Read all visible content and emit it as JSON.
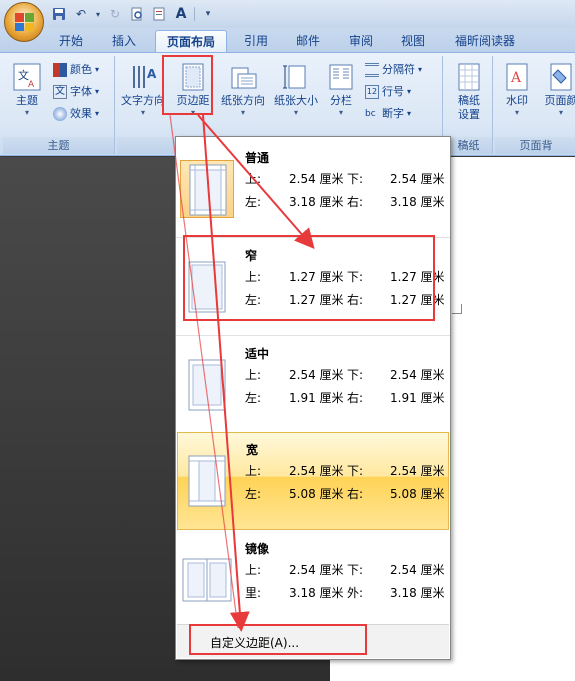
{
  "quick_access": {
    "undo": "↶",
    "redo": "↻",
    "more": "▾",
    "font_a": "A"
  },
  "tabs": [
    "开始",
    "插入",
    "页面布局",
    "引用",
    "邮件",
    "审阅",
    "视图",
    "福昕阅读器"
  ],
  "ribbon": {
    "theme_group": {
      "label": "主题",
      "big_button": "主题",
      "colors": "颜色",
      "fonts": "字体",
      "effects": "效果"
    },
    "page_setup_group": {
      "text_direction": "文字方向",
      "margins": "页边距",
      "orientation": "纸张方向",
      "size": "纸张大小",
      "columns": "分栏",
      "breaks": "分隔符",
      "line_numbers": "行号",
      "hyphenation": "断字"
    },
    "draft_group": {
      "label": "稿纸",
      "button_line1": "稿纸",
      "button_line2": "设置"
    },
    "background_group": {
      "label": "页面背",
      "watermark": "水印",
      "page_color": "页面颜"
    },
    "down_arrow": "▾"
  },
  "gallery": {
    "items": [
      {
        "name": "普通",
        "row1": [
          "上:",
          "2.54 厘米",
          "下:",
          "2.54 厘米"
        ],
        "row2": [
          "左:",
          "3.18 厘米",
          "右:",
          "3.18 厘米"
        ]
      },
      {
        "name": "窄",
        "row1": [
          "上:",
          "1.27 厘米",
          "下:",
          "1.27 厘米"
        ],
        "row2": [
          "左:",
          "1.27 厘米",
          "右:",
          "1.27 厘米"
        ]
      },
      {
        "name": "适中",
        "row1": [
          "上:",
          "2.54 厘米",
          "下:",
          "2.54 厘米"
        ],
        "row2": [
          "左:",
          "1.91 厘米",
          "右:",
          "1.91 厘米"
        ]
      },
      {
        "name": "宽",
        "row1": [
          "上:",
          "2.54 厘米",
          "下:",
          "2.54 厘米"
        ],
        "row2": [
          "左:",
          "5.08 厘米",
          "右:",
          "5.08 厘米"
        ]
      },
      {
        "name": "镜像",
        "row1": [
          "上:",
          "2.54 厘米",
          "下:",
          "2.54 厘米"
        ],
        "row2": [
          "里:",
          "3.18 厘米",
          "外:",
          "3.18 厘米"
        ]
      }
    ],
    "custom": "自定义边距(A)..."
  },
  "colors": {
    "annotation_red": "#e8393b",
    "hover_gold": "#ffd356",
    "ribbon_blue": "#dbe7f5"
  }
}
